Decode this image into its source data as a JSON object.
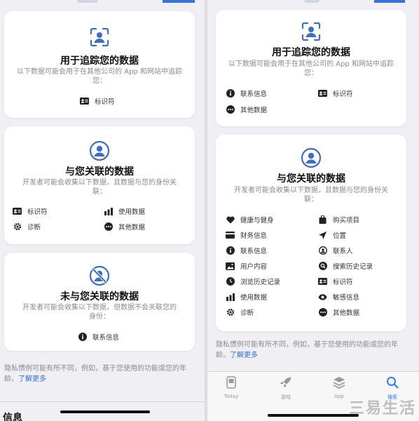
{
  "left": {
    "tracking": {
      "title": "用于追踪您的数据",
      "desc": "以下数据可能会用于在其他公司的 App 和网站中追踪您：",
      "items": [
        {
          "icon": "id-card-icon",
          "label": "标识符"
        }
      ]
    },
    "linked": {
      "title": "与您关联的数据",
      "desc": "开发者可能会收集以下数据，且数据与您的身份关联：",
      "items": [
        {
          "icon": "id-card-icon",
          "label": "标识符"
        },
        {
          "icon": "bar-chart-icon",
          "label": "使用数据"
        },
        {
          "icon": "gear-icon",
          "label": "诊断"
        },
        {
          "icon": "more-icon",
          "label": "其他数据"
        }
      ]
    },
    "not_linked": {
      "title": "未与您关联的数据",
      "desc": "开发者可能会收集以下数据，但数据不会关联您的身份：",
      "items": [
        {
          "icon": "info-icon",
          "label": "联系信息"
        }
      ]
    },
    "footnote": "隐私惯例可能有所不同，例如，基于您使用的功能或您的年龄。",
    "learn_more": "了解更多",
    "section_heading": "信息"
  },
  "right": {
    "tracking": {
      "title": "用于追踪您的数据",
      "desc": "以下数据可能会用于在其他公司的 App 和网站中追踪您：",
      "items": [
        {
          "icon": "info-icon",
          "label": "联系信息"
        },
        {
          "icon": "id-card-icon",
          "label": "标识符"
        },
        {
          "icon": "more-icon",
          "label": "其他数据"
        }
      ]
    },
    "linked": {
      "title": "与您关联的数据",
      "desc": "开发者可能会收集以下数据，且数据与您的身份关联：",
      "items": [
        {
          "icon": "heart-icon",
          "label": "健康与健身"
        },
        {
          "icon": "bag-icon",
          "label": "购买项目"
        },
        {
          "icon": "card-icon",
          "label": "财务信息"
        },
        {
          "icon": "location-icon",
          "label": "位置"
        },
        {
          "icon": "info-icon",
          "label": "联系信息"
        },
        {
          "icon": "contact-icon",
          "label": "联系人"
        },
        {
          "icon": "photo-icon",
          "label": "用户内容"
        },
        {
          "icon": "search-icon",
          "label": "搜索历史记录"
        },
        {
          "icon": "clock-icon",
          "label": "浏览历史记录"
        },
        {
          "icon": "id-card-icon",
          "label": "标识符"
        },
        {
          "icon": "bar-chart-icon",
          "label": "使用数据"
        },
        {
          "icon": "eye-icon",
          "label": "敏感信息"
        },
        {
          "icon": "gear-icon",
          "label": "诊断"
        },
        {
          "icon": "more-icon",
          "label": "其他数据"
        }
      ]
    },
    "footnote": "隐私惯例可能有所不同，例如，基于您使用的功能或您的年龄。",
    "learn_more": "了解更多",
    "tabs": [
      {
        "icon": "today-icon",
        "label": "Today"
      },
      {
        "icon": "rocket-icon",
        "label": "游戏"
      },
      {
        "icon": "stack-icon",
        "label": "App"
      },
      {
        "icon": "search-icon",
        "label": "搜索"
      }
    ]
  },
  "watermark": "三易生活",
  "colors": {
    "accent": "#2f7cf6",
    "icon_blue": "#3a6fc4",
    "background": "#efeff4",
    "card": "#ffffff"
  }
}
